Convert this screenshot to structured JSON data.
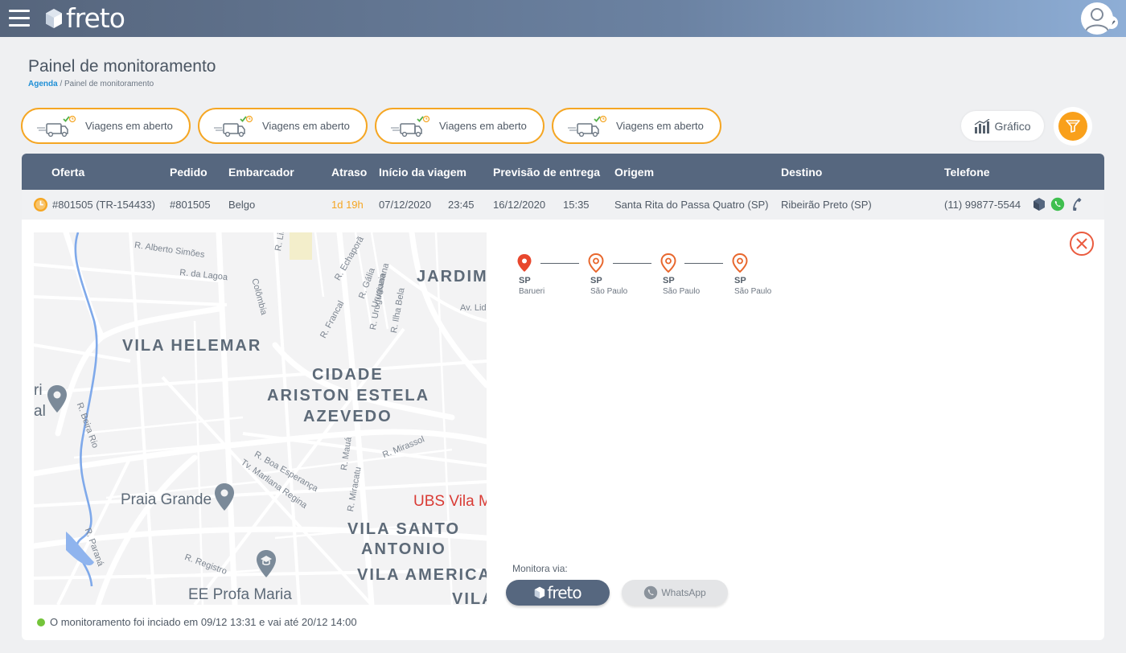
{
  "app": {
    "logo_text": "freto"
  },
  "page": {
    "title": "Painel de monitoramento"
  },
  "breadcrumb": {
    "home": "Agenda",
    "separator": "/",
    "current": "Painel de monitoramento"
  },
  "cards": [
    {
      "label": "Viagens em aberto"
    },
    {
      "label": "Viagens em aberto"
    },
    {
      "label": "Viagens em aberto"
    },
    {
      "label": "Viagens em aberto"
    }
  ],
  "toolbar": {
    "grafico_label": "Gráfico"
  },
  "table": {
    "columns": [
      "Oferta",
      "Pedido",
      "Embarcador",
      "Atraso",
      "Início da viagem",
      "Previsão de entrega",
      "Origem",
      "Destino",
      "Telefone"
    ],
    "row": {
      "oferta": "#801505 (TR-154433)",
      "pedido": "#801505",
      "embarcador": "Belgo",
      "atraso": "1d 19h",
      "inicio_data": "07/12/2020",
      "inicio_hora": "23:45",
      "previsao_data": "16/12/2020",
      "previsao_hora": "15:35",
      "origem": "Santa Rita do Passa Quatro (SP)",
      "destino": "Ribeirão Preto (SP)",
      "telefone": "(11) 99877-5544"
    }
  },
  "map": {
    "neighborhoods": [
      "VILA HELEMAR",
      "CIDADE",
      "ARISTON ESTELA",
      "AZEVEDO",
      "JARDIM",
      "VILA SANTO",
      "ANTONIO",
      "VILA AMERICA",
      "VILA"
    ],
    "streets": [
      "R. Alberto Simões",
      "R. da Lagoa",
      "R. Lins",
      "Colômbia",
      "R. Echaporã",
      "R. Gália",
      "Uruguaiana",
      "R. Francal",
      "R. Uruguaiana",
      "R. Ilha Bela",
      "Av. Lida",
      "R. Beira Rio",
      "R. Boa Esperança",
      "Tv. Marliana Regina",
      "R. Mauá",
      "R. Mirassol",
      "R. Miracatu",
      "R. Paraná",
      "R. Registro"
    ],
    "places": [
      "Praia Grande",
      "UBS Vila M",
      "EE Profa Maria",
      "ri",
      "al"
    ]
  },
  "status": {
    "message": "O monitoramento foi inciado em 09/12 13:31 e vai até 20/12 14:00",
    "color": "#74c43a"
  },
  "route": {
    "stops": [
      {
        "uf": "SP",
        "city": "Barueri",
        "color": "#e8472d"
      },
      {
        "uf": "SP",
        "city": "São Paulo",
        "color": "#e8672d"
      },
      {
        "uf": "SP",
        "city": "São Paulo",
        "color": "#e8672d"
      },
      {
        "uf": "SP",
        "city": "São Paulo",
        "color": "#e8672d"
      }
    ]
  },
  "monitor": {
    "label": "Monitora via:",
    "freto_label": "freto",
    "whatsapp_label": "WhatsApp"
  },
  "colors": {
    "accent": "#f5a623",
    "header": "#56677f",
    "brand_red": "#e8472d"
  }
}
